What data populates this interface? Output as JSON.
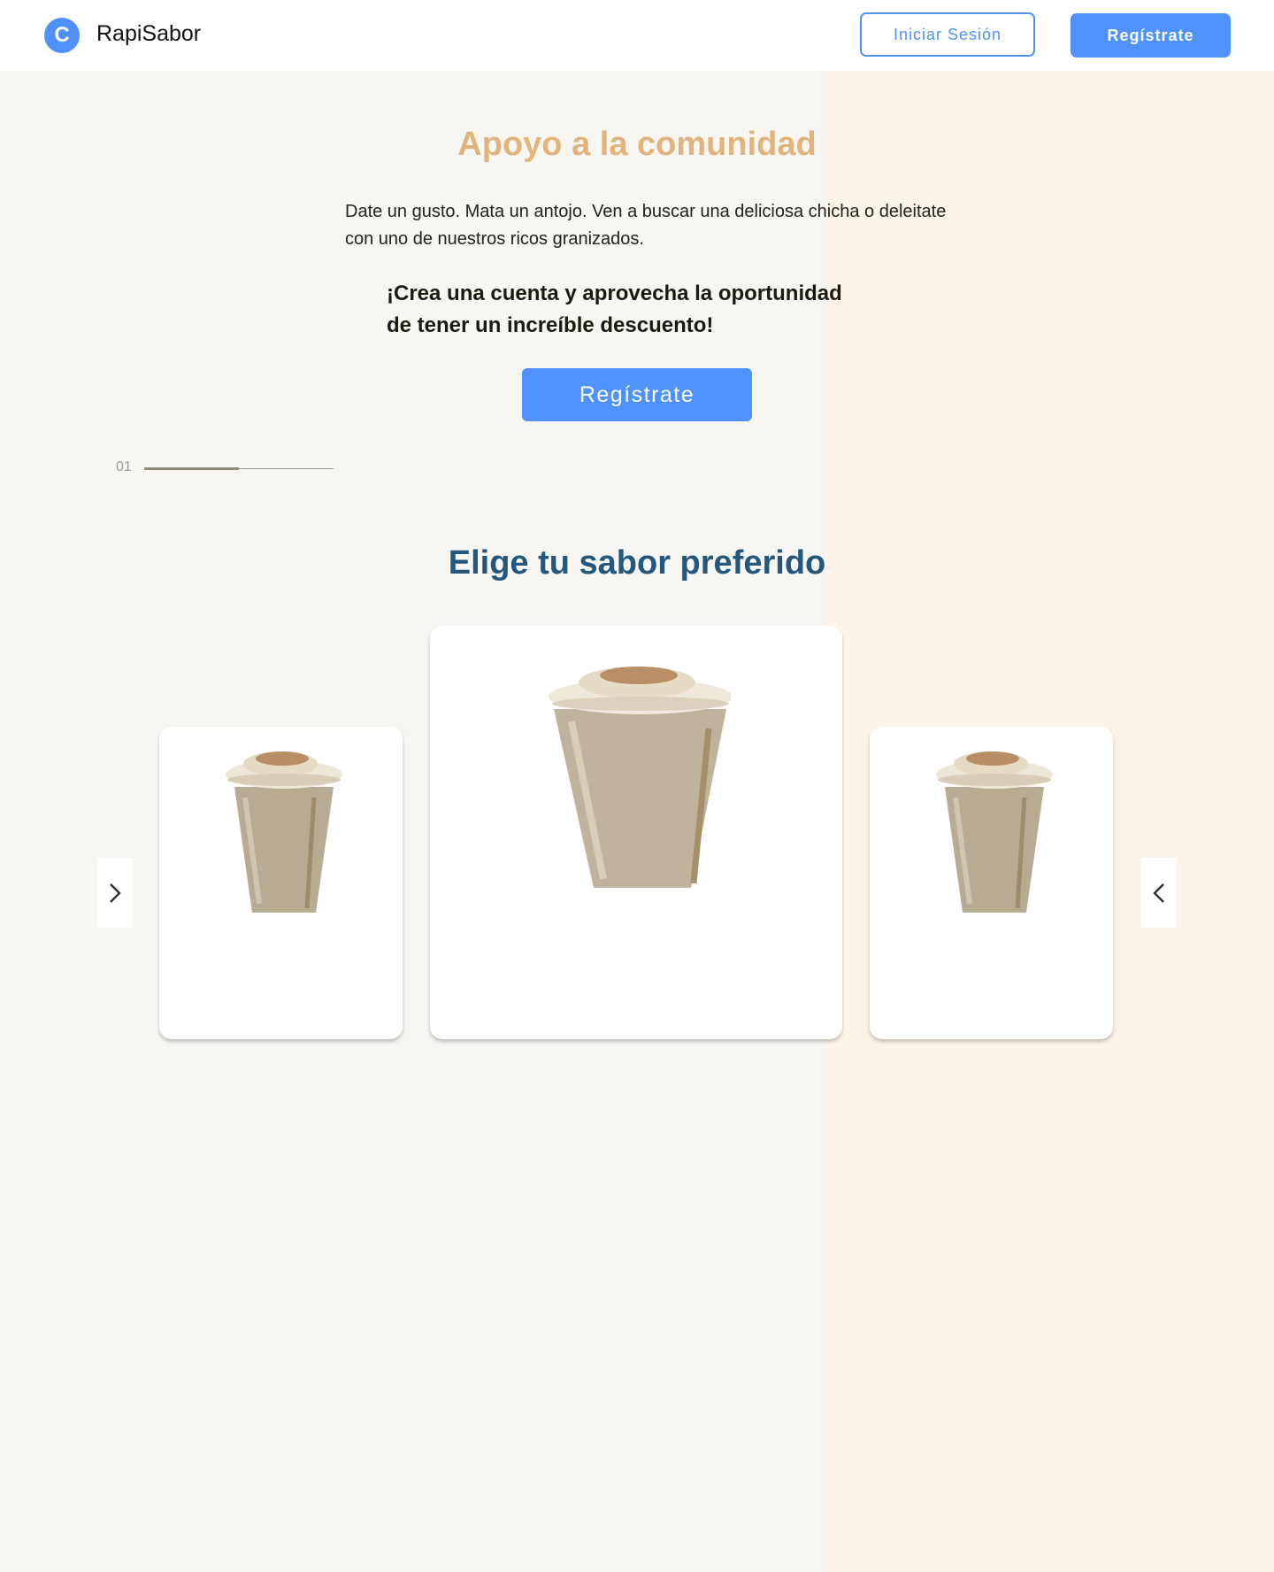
{
  "header": {
    "logo_letter": "C",
    "brand": "RapiSabor",
    "login_label": "Iniciar Sesión",
    "register_label": "Regístrate"
  },
  "hero": {
    "title": "Apoyo a la comunidad",
    "description": "Date un gusto. Mata un antojo. Ven a buscar una deliciosa chicha o deleitate con uno de nuestros ricos granizados.",
    "cta_line1": "¡Crea una cuenta y aprovecha la oportunidad",
    "cta_line2": "de tener un increíble descuento!",
    "register_label": "Regístrate"
  },
  "slider": {
    "current": "01",
    "progress": 0.5
  },
  "flavors": {
    "title": "Elige tu sabor preferido",
    "cards": [
      {
        "image": "drink-image"
      },
      {
        "image": "drink-image"
      },
      {
        "image": "drink-image"
      }
    ],
    "prev_icon": "chevron-right-icon",
    "next_icon": "chevron-left-icon"
  },
  "colors": {
    "accent": "#4f92fb",
    "hero_title": "#e0b47c",
    "section_title": "#24577e",
    "background_left": "#f8f6f2",
    "background_right": "#fdf4e9"
  }
}
